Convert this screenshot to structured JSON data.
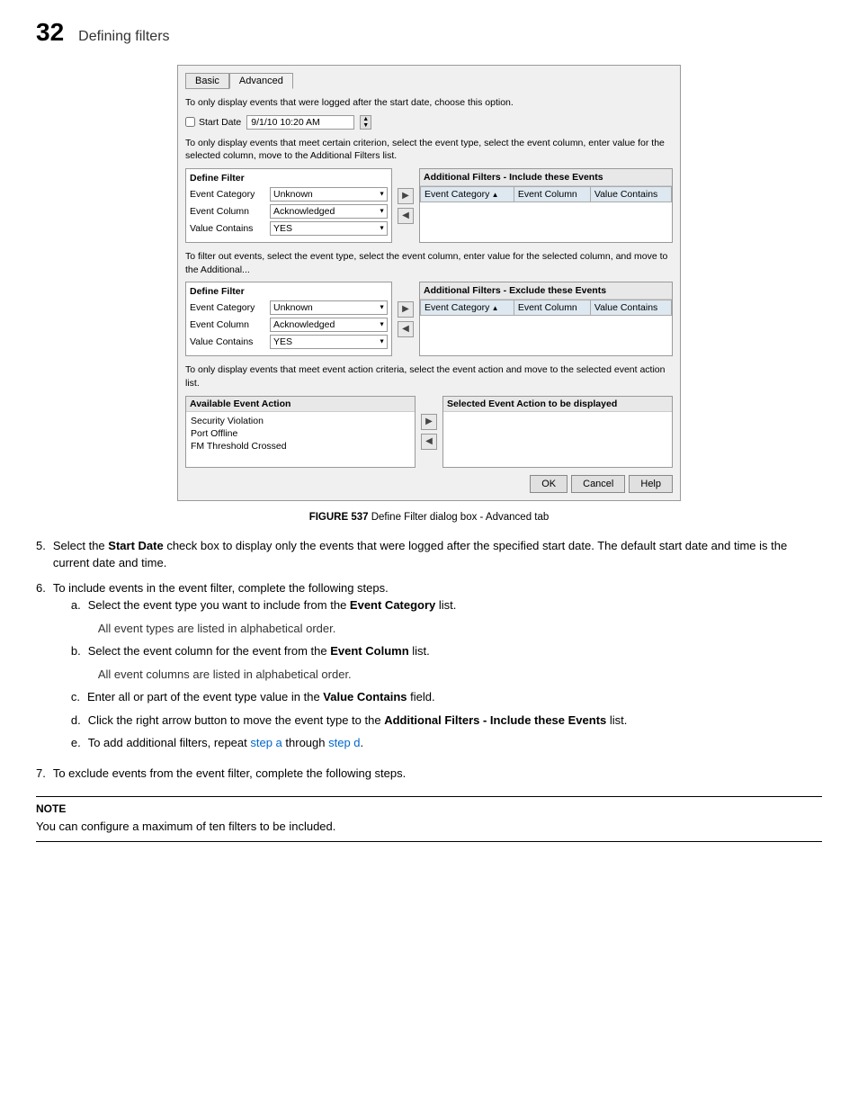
{
  "page": {
    "number": "32",
    "title": "Defining filters"
  },
  "dialog": {
    "tabs": [
      {
        "label": "Basic",
        "active": false
      },
      {
        "label": "Advanced",
        "active": true
      }
    ],
    "desc1": "To only display events that were logged after the start date, choose this option.",
    "start_date_label": "Start Date",
    "start_date_value": "9/1/10 10:20 AM",
    "desc2": "To only display events that meet certain criterion, select the event type, select the event column, enter value for the selected column, move to the Additional Filters list.",
    "include_section": {
      "define_filter_title": "Define Filter",
      "event_category_label": "Event Category",
      "event_category_value": "Unknown",
      "event_column_label": "Event Column",
      "event_column_value": "Acknowledged",
      "value_contains_label": "Value Contains",
      "value_contains_value": "YES",
      "additional_filters_title": "Additional Filters - Include these Events",
      "col_event_category": "Event Category",
      "col_event_column": "Event Column",
      "col_value_contains": "Value Contains"
    },
    "desc3": "To filter out events, select the event type, select the event column, enter value for the selected column, and move to the Additional...",
    "exclude_section": {
      "define_filter_title": "Define Filter",
      "event_category_label": "Event Category",
      "event_category_value": "Unknown",
      "event_column_label": "Event Column",
      "event_column_value": "Acknowledged",
      "value_contains_label": "Value Contains",
      "value_contains_value": "YES",
      "additional_filters_title": "Additional Filters - Exclude these Events",
      "col_event_category": "Event Category",
      "col_event_column": "Event Column",
      "col_value_contains": "Value Contains"
    },
    "desc4": "To only display events that meet event action criteria, select the event action and move to the selected event action list.",
    "available_action_title": "Available Event Action",
    "available_actions": [
      "Security Violation",
      "Port Offline",
      "FM Threshold Crossed"
    ],
    "selected_action_title": "Selected Event Action to be displayed",
    "buttons": {
      "ok": "OK",
      "cancel": "Cancel",
      "help": "Help"
    }
  },
  "figure_caption": "FIGURE 537   Define Filter dialog box - Advanced tab",
  "steps": [
    {
      "number": "5.",
      "text_before": "Select the ",
      "bold_term": "Start Date",
      "text_after": " check box to display only the events that were logged after the specified start date. The default start date and time is the current date and time."
    },
    {
      "number": "6.",
      "text": "To include events in the event filter, complete the following steps.",
      "sub_steps": [
        {
          "letter": "a.",
          "text_before": "Select the event type you want to include from the ",
          "bold_term": "Event Category",
          "text_after": " list.",
          "sub_text": "All event types are listed in alphabetical order."
        },
        {
          "letter": "b.",
          "text_before": "Select the event column for the event from the ",
          "bold_term": "Event Column",
          "text_after": " list.",
          "sub_text": "All event columns are listed in alphabetical order."
        },
        {
          "letter": "c.",
          "text_before": "Enter all or part of the event type value in the ",
          "bold_term": "Value Contains",
          "text_after": " field."
        },
        {
          "letter": "d.",
          "text_before": "Click the right arrow button to move the event type to the ",
          "bold_term": "Additional Filters - Include these Events",
          "text_after": " list."
        },
        {
          "letter": "e.",
          "text_before": "To add additional filters, repeat ",
          "link1_text": "step a",
          "text_between": " through ",
          "link2_text": "step d",
          "text_after": "."
        }
      ]
    },
    {
      "number": "7.",
      "text": "To exclude events from the event filter, complete the following steps."
    }
  ],
  "note": {
    "title": "NOTE",
    "content": "You can configure a maximum of ten filters to be included."
  }
}
